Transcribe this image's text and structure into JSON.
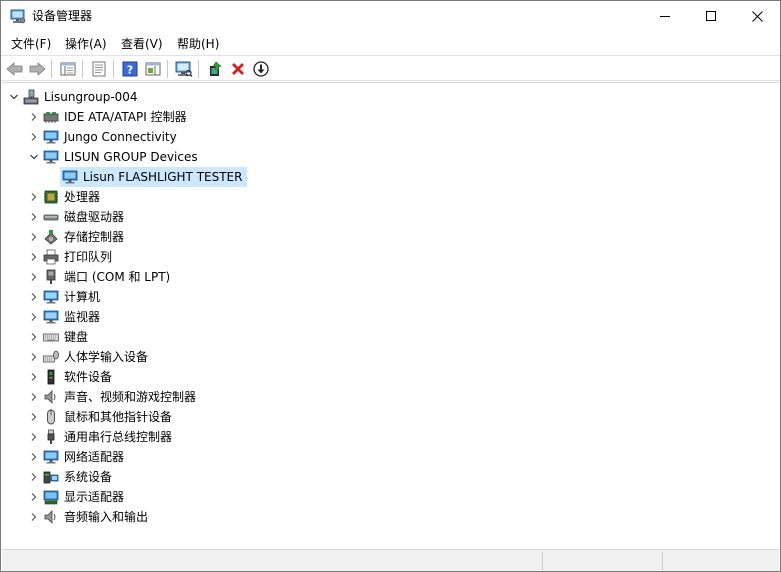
{
  "window": {
    "title": "设备管理器"
  },
  "menu": [
    {
      "label": "文件(F)"
    },
    {
      "label": "操作(A)"
    },
    {
      "label": "查看(V)"
    },
    {
      "label": "帮助(H)"
    }
  ],
  "tree": {
    "root": "Lisungroup-004",
    "items": [
      {
        "label": "IDE ATA/ATAPI 控制器",
        "icon": "ide-controller-icon",
        "expanded": false
      },
      {
        "label": "Jungo Connectivity",
        "icon": "network-monitor-icon",
        "expanded": false
      },
      {
        "label": "LISUN GROUP Devices",
        "icon": "network-monitor-icon",
        "expanded": true
      },
      {
        "label": "Lisun FLASHLIGHT TESTER",
        "icon": "network-monitor-icon",
        "child": true,
        "selected": true
      },
      {
        "label": "处理器",
        "icon": "processor-icon",
        "expanded": false
      },
      {
        "label": "磁盘驱动器",
        "icon": "disk-drive-icon",
        "expanded": false
      },
      {
        "label": "存储控制器",
        "icon": "storage-controller-icon",
        "expanded": false
      },
      {
        "label": "打印队列",
        "icon": "printer-icon",
        "expanded": false
      },
      {
        "label": "端口 (COM 和 LPT)",
        "icon": "port-icon",
        "expanded": false
      },
      {
        "label": "计算机",
        "icon": "computer-icon",
        "expanded": false
      },
      {
        "label": "监视器",
        "icon": "monitor-icon",
        "expanded": false
      },
      {
        "label": "键盘",
        "icon": "keyboard-icon",
        "expanded": false
      },
      {
        "label": "人体学输入设备",
        "icon": "hid-icon",
        "expanded": false
      },
      {
        "label": "软件设备",
        "icon": "software-device-icon",
        "expanded": false
      },
      {
        "label": "声音、视频和游戏控制器",
        "icon": "speaker-icon",
        "expanded": false
      },
      {
        "label": "鼠标和其他指针设备",
        "icon": "mouse-icon",
        "expanded": false
      },
      {
        "label": "通用串行总线控制器",
        "icon": "usb-icon",
        "expanded": false
      },
      {
        "label": "网络适配器",
        "icon": "network-adapter-icon",
        "expanded": false
      },
      {
        "label": "系统设备",
        "icon": "system-device-icon",
        "expanded": false
      },
      {
        "label": "显示适配器",
        "icon": "display-adapter-icon",
        "expanded": false
      },
      {
        "label": "音频输入和输出",
        "icon": "audio-io-icon",
        "expanded": false
      }
    ]
  },
  "colors": {
    "selection": "#cce8ff",
    "uninstall_red": "#d81e1e",
    "update_green": "#2e9e3a",
    "help_blue": "#3b6bd6"
  }
}
